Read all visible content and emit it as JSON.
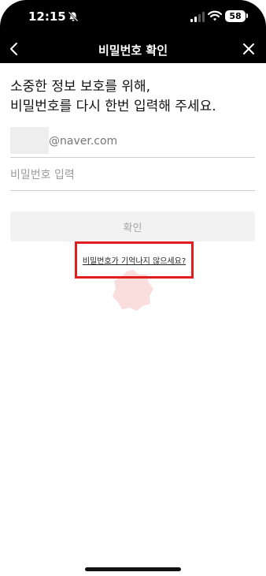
{
  "status_bar": {
    "time": "12:15",
    "battery": "58",
    "icons": [
      "bell-slash-icon",
      "signal-icon",
      "wifi-icon",
      "battery-icon"
    ]
  },
  "nav": {
    "title": "비밀번호 확인",
    "back_icon": "chevron-left-icon",
    "close_icon": "close-icon"
  },
  "headline": {
    "line1": "소중한 정보 보호를 위해,",
    "line2": "비밀번호를 다시 한번 입력해 주세요."
  },
  "form": {
    "id_domain": "@naver.com",
    "password_placeholder": "비밀번호 입력",
    "confirm_label": "확인"
  },
  "forgot_password_link": "비밀번호가 기억나지 않으세요?",
  "colors": {
    "header_bg": "#000000",
    "highlight": "#e01e1e",
    "button_bg": "#f2f2f2",
    "button_text": "#a8a8a8"
  }
}
